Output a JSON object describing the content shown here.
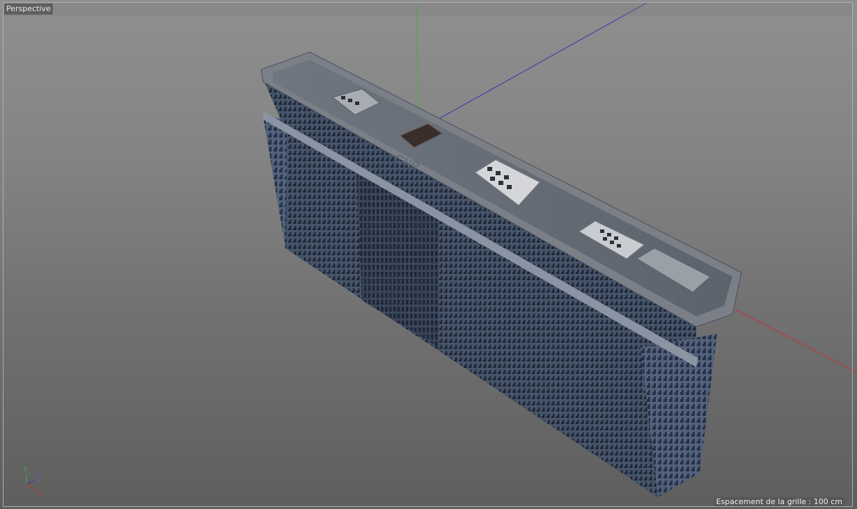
{
  "viewport": {
    "label": "Perspective",
    "grid_spacing": "Espacement de la grille : 100 cm"
  },
  "building": {
    "roof_sign": "CNP"
  },
  "axis_gizmo": {
    "x_label": "X",
    "y_label": "Y",
    "z_label": "Z"
  },
  "colors": {
    "x_axis": "#c83a3a",
    "y_axis": "#2fae2f",
    "z_axis": "#3a3ab8"
  }
}
